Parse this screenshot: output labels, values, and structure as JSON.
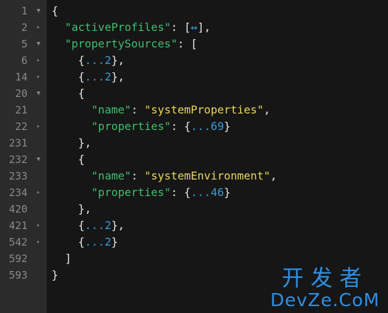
{
  "lines": [
    {
      "num": "1",
      "fold": "▼",
      "code": [
        {
          "t": "{",
          "c": "p"
        }
      ]
    },
    {
      "num": "2",
      "fold": "▸",
      "code": [
        {
          "t": "  ",
          "c": "p"
        },
        {
          "t": "\"activeProfiles\"",
          "c": "k"
        },
        {
          "t": ": [",
          "c": "p"
        },
        {
          "t": "↔",
          "c": "c"
        },
        {
          "t": "],",
          "c": "p"
        }
      ]
    },
    {
      "num": "5",
      "fold": "▼",
      "code": [
        {
          "t": "  ",
          "c": "p"
        },
        {
          "t": "\"propertySources\"",
          "c": "k"
        },
        {
          "t": ": [",
          "c": "p"
        }
      ]
    },
    {
      "num": "6",
      "fold": "▸",
      "code": [
        {
          "t": "    {",
          "c": "p"
        },
        {
          "t": "...2",
          "c": "c"
        },
        {
          "t": "},",
          "c": "p"
        }
      ]
    },
    {
      "num": "14",
      "fold": "▸",
      "code": [
        {
          "t": "    {",
          "c": "p"
        },
        {
          "t": "...2",
          "c": "c"
        },
        {
          "t": "},",
          "c": "p"
        }
      ]
    },
    {
      "num": "20",
      "fold": "▼",
      "code": [
        {
          "t": "    {",
          "c": "p"
        }
      ]
    },
    {
      "num": "21",
      "fold": "",
      "code": [
        {
          "t": "      ",
          "c": "p"
        },
        {
          "t": "\"name\"",
          "c": "k"
        },
        {
          "t": ": ",
          "c": "p"
        },
        {
          "t": "\"systemProperties\"",
          "c": "s"
        },
        {
          "t": ",",
          "c": "p"
        }
      ]
    },
    {
      "num": "22",
      "fold": "▸",
      "code": [
        {
          "t": "      ",
          "c": "p"
        },
        {
          "t": "\"properties\"",
          "c": "k"
        },
        {
          "t": ": {",
          "c": "p"
        },
        {
          "t": "...69",
          "c": "c"
        },
        {
          "t": "}",
          "c": "p"
        }
      ]
    },
    {
      "num": "231",
      "fold": "",
      "code": [
        {
          "t": "    },",
          "c": "p"
        }
      ]
    },
    {
      "num": "232",
      "fold": "▼",
      "code": [
        {
          "t": "    {",
          "c": "p"
        }
      ]
    },
    {
      "num": "233",
      "fold": "",
      "code": [
        {
          "t": "      ",
          "c": "p"
        },
        {
          "t": "\"name\"",
          "c": "k"
        },
        {
          "t": ": ",
          "c": "p"
        },
        {
          "t": "\"systemEnvironment\"",
          "c": "s"
        },
        {
          "t": ",",
          "c": "p"
        }
      ]
    },
    {
      "num": "234",
      "fold": "▸",
      "code": [
        {
          "t": "      ",
          "c": "p"
        },
        {
          "t": "\"properties\"",
          "c": "k"
        },
        {
          "t": ": {",
          "c": "p"
        },
        {
          "t": "...46",
          "c": "c"
        },
        {
          "t": "}",
          "c": "p"
        }
      ]
    },
    {
      "num": "420",
      "fold": "",
      "code": [
        {
          "t": "    },",
          "c": "p"
        }
      ]
    },
    {
      "num": "421",
      "fold": "▸",
      "code": [
        {
          "t": "    {",
          "c": "p"
        },
        {
          "t": "...2",
          "c": "c"
        },
        {
          "t": "},",
          "c": "p"
        }
      ]
    },
    {
      "num": "542",
      "fold": "▸",
      "code": [
        {
          "t": "    {",
          "c": "p"
        },
        {
          "t": "...2",
          "c": "c"
        },
        {
          "t": "}",
          "c": "p"
        }
      ]
    },
    {
      "num": "592",
      "fold": "",
      "code": [
        {
          "t": "  ]",
          "c": "p"
        }
      ]
    },
    {
      "num": "593",
      "fold": "",
      "code": [
        {
          "t": "}",
          "c": "p"
        }
      ]
    }
  ],
  "watermark": {
    "cn": "开发者",
    "en": "DevZe.CoM"
  },
  "colors": {
    "key": "#3fbf6f",
    "string": "#e6d85a",
    "count": "#3a9ad9",
    "punct": "#e6e6e6",
    "gutter": "#2b2b2b",
    "bg": "#161616"
  }
}
